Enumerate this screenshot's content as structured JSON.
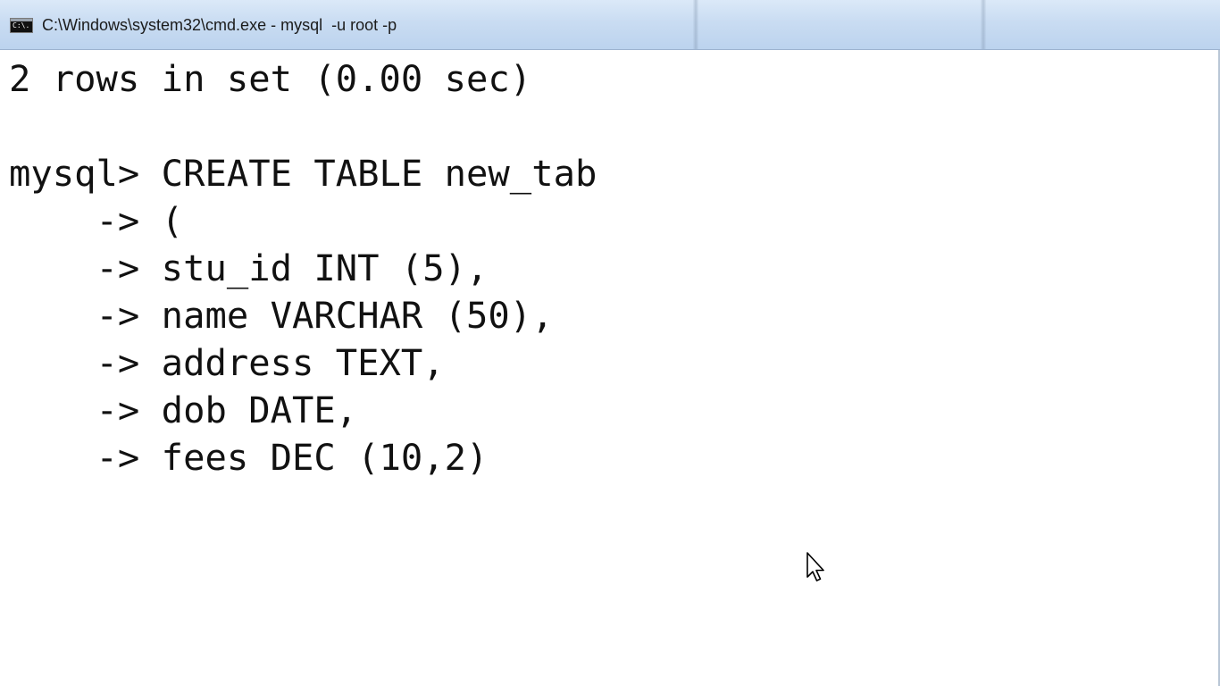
{
  "window": {
    "title": "C:\\Windows\\system32\\cmd.exe - mysql  -u root -p",
    "icon": "cmd-icon",
    "icon_glyph": "C:\\."
  },
  "console": {
    "lines": [
      "2 rows in set (0.00 sec)",
      "",
      "mysql> CREATE TABLE new_tab",
      "    -> (",
      "    -> stu_id INT (5),",
      "    -> name VARCHAR (50),",
      "    -> address TEXT,",
      "    -> dob DATE,",
      "    -> fees DEC (10,2)"
    ]
  },
  "cursor": {
    "icon": "mouse-pointer-icon"
  },
  "colors": {
    "titlebar": "#c9dcf2",
    "console_bg": "#ffffff",
    "console_text": "#111111"
  }
}
